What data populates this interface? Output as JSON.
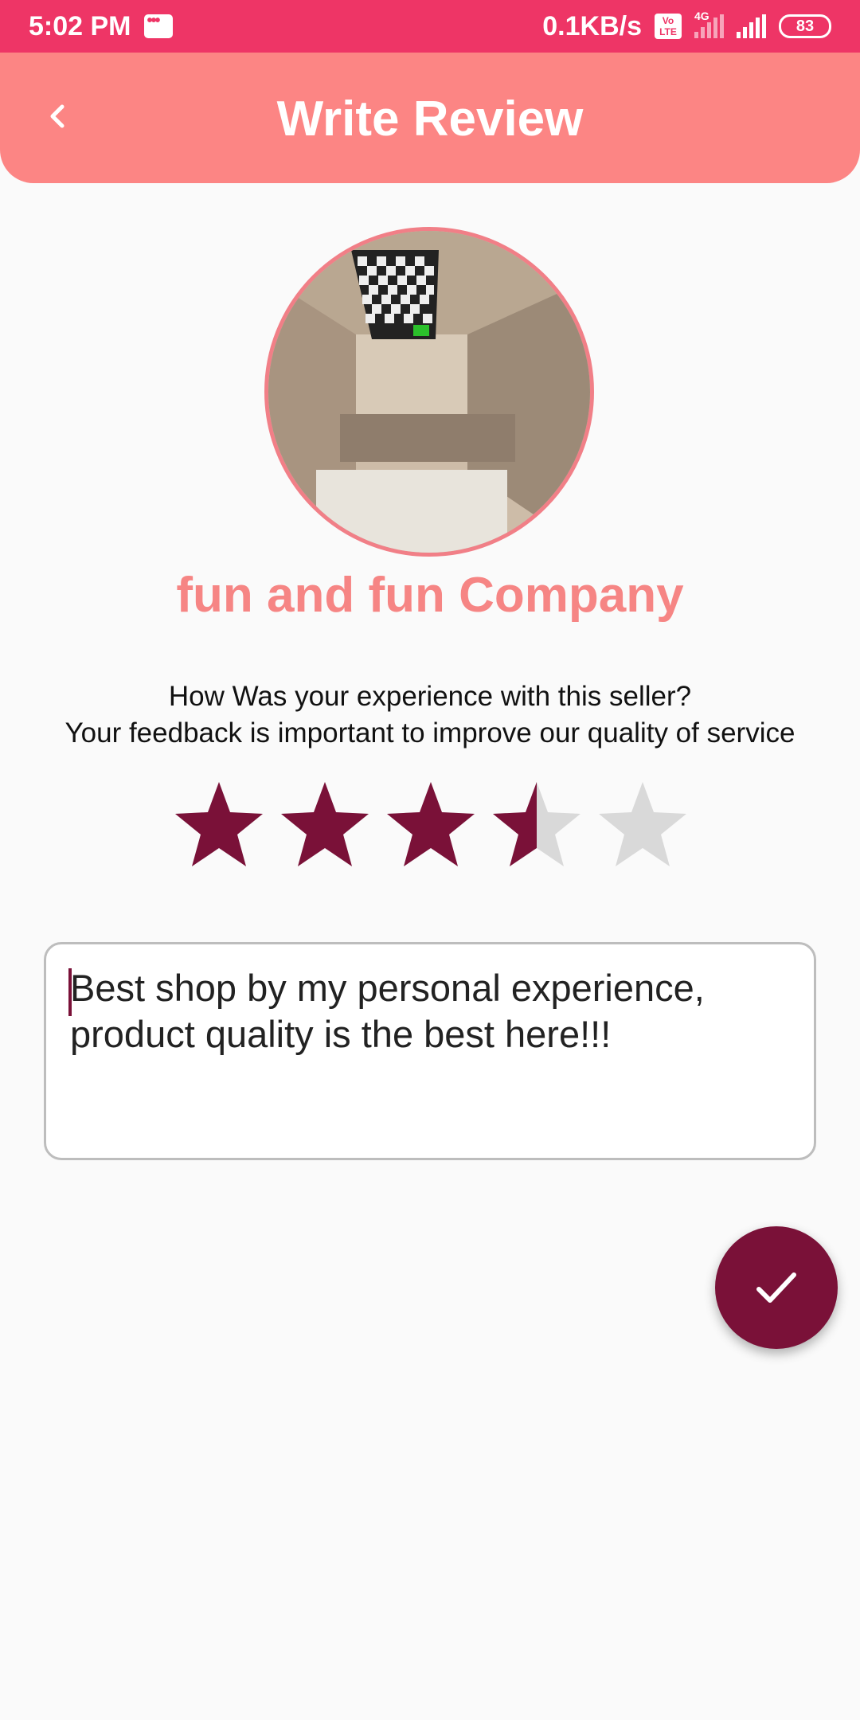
{
  "status_bar": {
    "time": "5:02 PM",
    "speed": "0.1KB/s",
    "volte": "Vo LTE",
    "network": "4G",
    "battery": "83"
  },
  "app_bar": {
    "title": "Write Review",
    "back_icon": "chevron-left-icon"
  },
  "seller": {
    "name": "fun and fun Company"
  },
  "prompt": {
    "line1": "How Was your experience with this seller?",
    "line2": "Your feedback is important to improve our quality of service"
  },
  "rating": {
    "value": 3.5,
    "max": 5,
    "filled_color": "#7a1138",
    "empty_color": "#d9d9d9"
  },
  "review": {
    "text_line1": "Best shop by my personal experience,",
    "text_line2": "product quality is the best here!!!"
  },
  "fab": {
    "icon": "check-icon"
  },
  "colors": {
    "status_bar": "#ee3566",
    "app_bar": "#fc8584",
    "accent": "#7a1138",
    "company_name": "#f68584"
  }
}
